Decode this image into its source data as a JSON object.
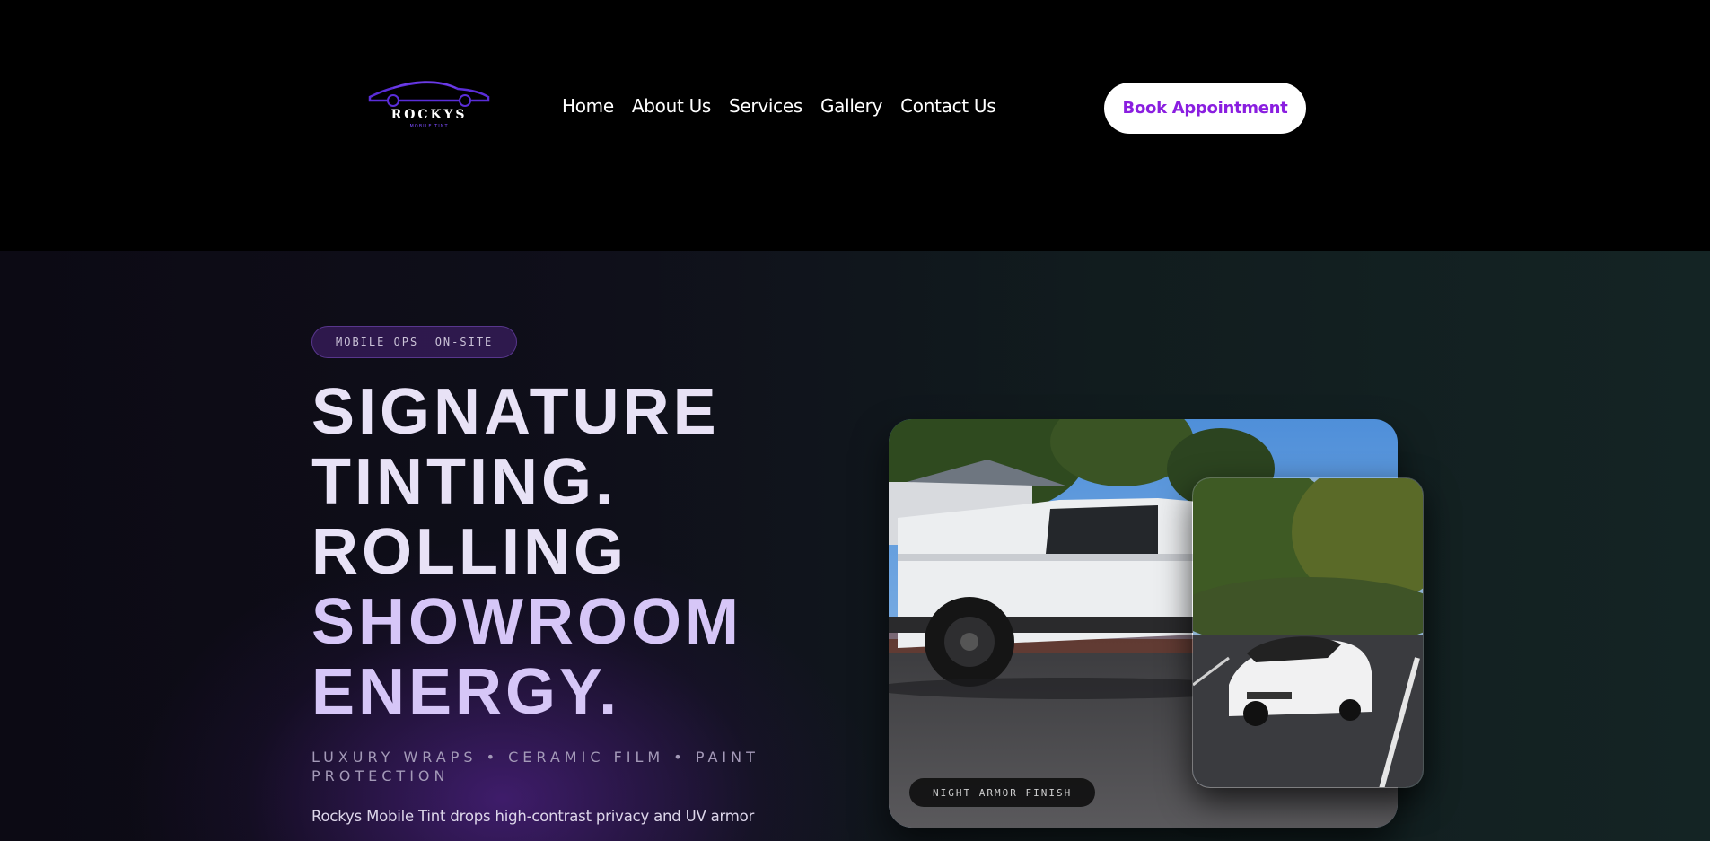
{
  "brand": {
    "name": "ROCKYS",
    "tagline": "MOBILE TINT",
    "accent": "#8a1ee0",
    "logo_color": "#5a2dd8"
  },
  "nav": {
    "items": [
      {
        "label": "Home"
      },
      {
        "label": "About Us"
      },
      {
        "label": "Services"
      },
      {
        "label": "Gallery"
      },
      {
        "label": "Contact Us"
      }
    ],
    "cta_label": "Book Appointment"
  },
  "hero": {
    "badge": "MOBILE OPS  ON-SITE",
    "title_lines": [
      "SIGNATURE",
      "TINTING.",
      "ROLLING",
      "SHOWROOM",
      "ENERGY."
    ],
    "subtitle": "LUXURY WRAPS • CERAMIC FILM • PAINT PROTECTION",
    "description": "Rockys Mobile Tint drops high-contrast privacy and UV armor",
    "photo_caption": "NIGHT ARMOR FINISH"
  }
}
